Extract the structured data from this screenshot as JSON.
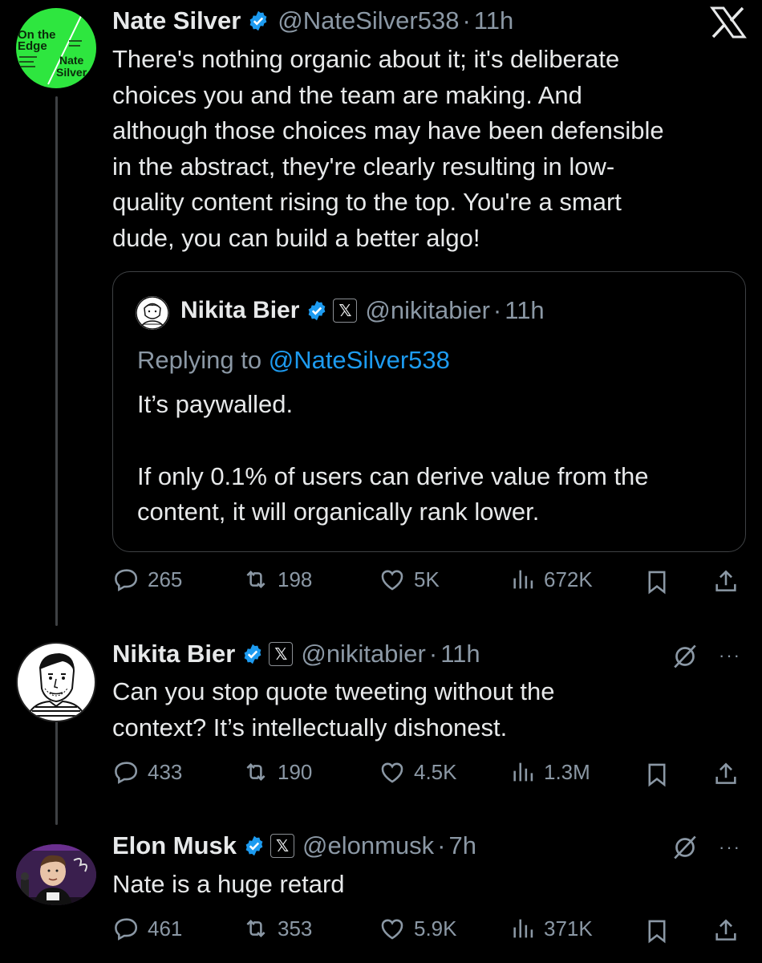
{
  "top": {
    "close_glyph": "X"
  },
  "tweet1": {
    "name": "Nate Silver",
    "handle": "@NateSilver538",
    "sep": "·",
    "time": "11h",
    "avatar_text": [
      "On the",
      "Edge",
      "Nate",
      "Silver"
    ],
    "lines": [
      "There's nothing organic about it; it's deliberate",
      "choices you and the team are making. And",
      "although those choices may have been defensible",
      "in the abstract, they're clearly resulting in low-",
      "quality content rising to the top. You're a smart",
      "dude, you can build a better algo!"
    ],
    "quote": {
      "name": "Nikita Bier",
      "handle": "@nikitabier",
      "sep": "·",
      "time": "11h",
      "replying_prefix": "Replying to ",
      "replying_handle": "@NateSilver538",
      "line1": "It’s paywalled.",
      "line2": "If only 0.1% of users can derive value from the",
      "line3": "content, it will organically rank lower."
    },
    "stats": {
      "replies": "265",
      "reposts": "198",
      "likes": "5K",
      "views": "672K"
    }
  },
  "tweet2": {
    "name": "Nikita Bier",
    "handle": "@nikitabier",
    "sep": "·",
    "time": "11h",
    "lines": [
      "Can you stop quote tweeting without the",
      "context? It’s intellectually dishonest."
    ],
    "stats": {
      "replies": "433",
      "reposts": "190",
      "likes": "4.5K",
      "views": "1.3M"
    },
    "more": "···"
  },
  "tweet3": {
    "name": "Elon Musk",
    "handle": "@elonmusk",
    "sep": "·",
    "time": "7h",
    "lines": [
      "Nate is a huge retard"
    ],
    "stats": {
      "replies": "461",
      "reposts": "353",
      "likes": "5.9K",
      "views": "371K"
    },
    "more": "···"
  },
  "colors": {
    "accent": "#1d9bf0",
    "muted": "#8b98a5",
    "avatar_green": "#2ee63f"
  },
  "icons": [
    "reply-icon",
    "repost-icon",
    "like-icon",
    "views-icon",
    "bookmark-icon",
    "share-icon",
    "verified-icon",
    "x-badge-icon",
    "grok-icon",
    "more-icon",
    "x-logo-icon"
  ]
}
